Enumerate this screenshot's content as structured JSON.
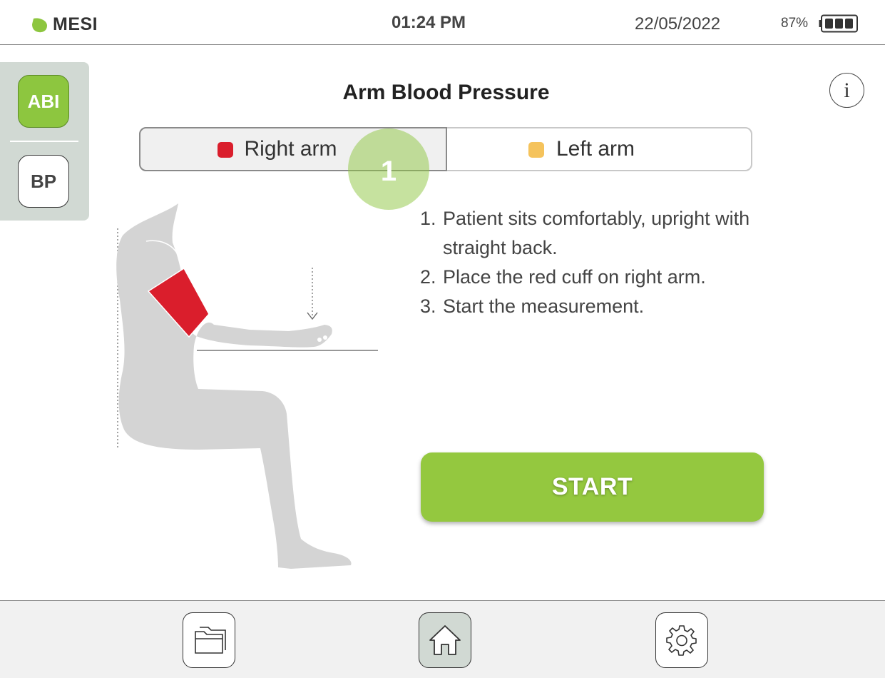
{
  "status_bar": {
    "brand": "MESI",
    "time": "01:24 PM",
    "date": "22/05/2022",
    "battery_percent": "87%",
    "battery_level": 0.87
  },
  "mode_rail": {
    "abi_label": "ABI",
    "bp_label": "BP",
    "active": "ABI"
  },
  "page": {
    "title": "Arm Blood Pressure"
  },
  "arm_selector": {
    "right_label": "Right arm",
    "left_label": "Left arm",
    "selected": "Right arm",
    "right_color": "#da1e2c",
    "left_color": "#f5c35c"
  },
  "step_badge": "1",
  "instructions": [
    {
      "num": "1.",
      "text": "Patient sits comfortably, upright with straight back."
    },
    {
      "num": "2.",
      "text": "Place the red cuff on right arm."
    },
    {
      "num": "3.",
      "text": "Start the measurement."
    }
  ],
  "start_button": "START",
  "colors": {
    "accent": "#94c83f",
    "rail": "#d1d9d3",
    "cuff": "#da1e2c"
  },
  "icons": {
    "info": "info-icon",
    "records": "folder-icon",
    "home": "home-icon",
    "settings": "gear-icon"
  }
}
